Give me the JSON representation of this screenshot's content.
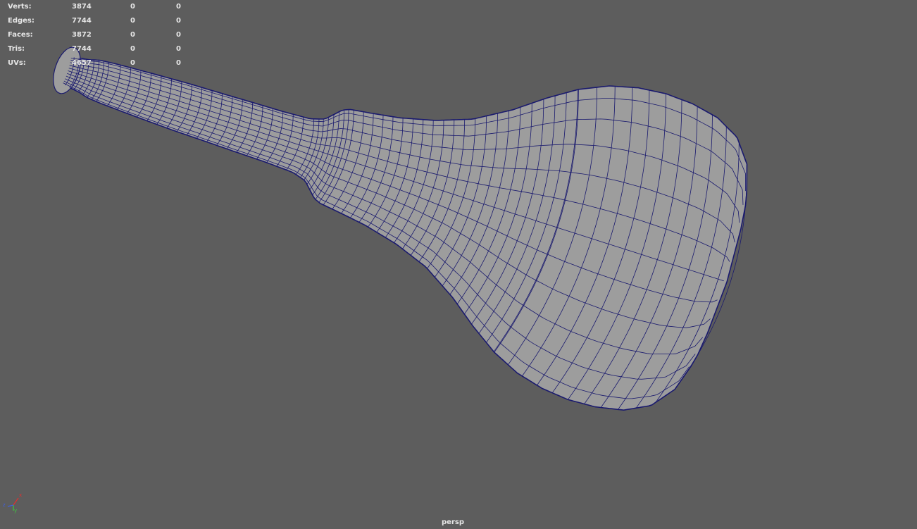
{
  "stats": [
    {
      "label": "Verts:",
      "c1": "3874",
      "c2": "0",
      "c3": "0"
    },
    {
      "label": "Edges:",
      "c1": "7744",
      "c2": "0",
      "c3": "0"
    },
    {
      "label": "Faces:",
      "c1": "3872",
      "c2": "0",
      "c3": "0"
    },
    {
      "label": "Tris:",
      "c1": "7744",
      "c2": "0",
      "c3": "0"
    },
    {
      "label": "UVs:",
      "c1": "4657",
      "c2": "0",
      "c3": "0"
    }
  ],
  "camera": "persp",
  "axis": {
    "x": "x",
    "y": "y",
    "z": "z"
  },
  "colors": {
    "background": "#5d5d5d",
    "surface": "#9d9d9d",
    "wire": "#1a1a6e",
    "hud_text": "#e6e6e6",
    "axis_x": "#e03030",
    "axis_y": "#40c040",
    "axis_z": "#4060e0"
  },
  "icons": [
    "axis-gizmo-icon"
  ]
}
